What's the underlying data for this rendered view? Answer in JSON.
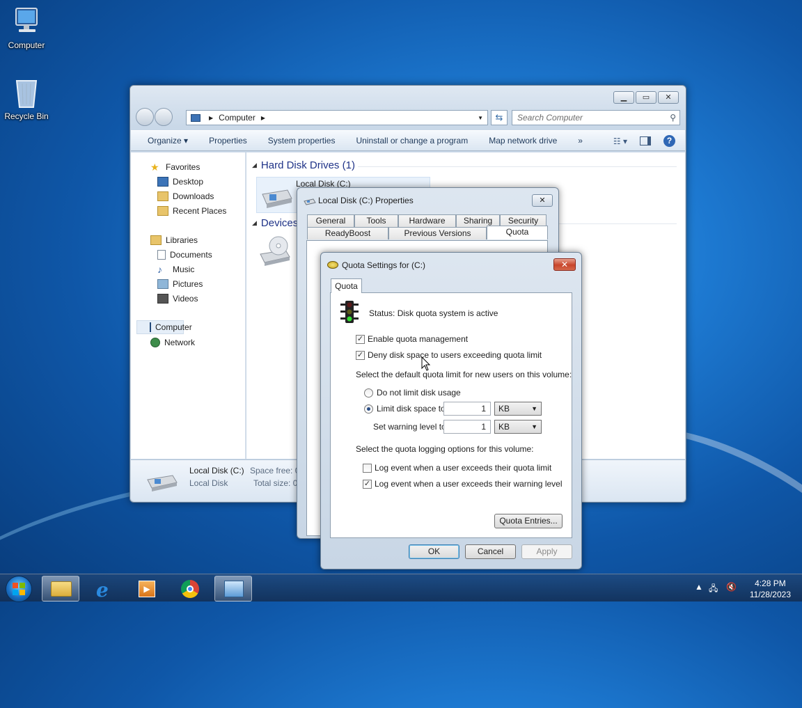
{
  "desktop": {
    "icons": [
      {
        "label": "Computer"
      },
      {
        "label": "Recycle Bin"
      }
    ]
  },
  "explorer": {
    "address": {
      "location": "Computer"
    },
    "search_placeholder": "Search Computer",
    "toolbar": [
      "Organize",
      "Properties",
      "System properties",
      "Uninstall or change a program",
      "Map network drive"
    ],
    "toolbar_more": "»",
    "nav": {
      "favorites": "Favorites",
      "favorites_items": [
        "Desktop",
        "Downloads",
        "Recent Places"
      ],
      "libraries": "Libraries",
      "libraries_items": [
        "Documents",
        "Music",
        "Pictures",
        "Videos"
      ],
      "computer": "Computer",
      "network": "Network"
    },
    "groups": {
      "hard_disks": "Hard Disk Drives (1)",
      "devices": "Devices"
    },
    "drive_label": "Local Disk (C:)",
    "details": {
      "name": "Local Disk (C:)",
      "type": "Local Disk",
      "space_free": "Space free: 0",
      "total_size": "Total size: 0"
    }
  },
  "properties_dialog": {
    "title": "Local Disk (C:) Properties",
    "tabs_row1": [
      "General",
      "Tools",
      "Hardware",
      "Sharing",
      "Security"
    ],
    "tabs_row2": [
      "ReadyBoost",
      "Previous Versions",
      "Quota"
    ],
    "active_tab": "Quota"
  },
  "quota_dialog": {
    "title": "Quota Settings for  (C:)",
    "tab": "Quota",
    "status": "Status:  Disk quota system is active",
    "enable_label": "Enable quota management",
    "enable_checked": true,
    "deny_label": "Deny disk space to users exceeding quota limit",
    "deny_checked": true,
    "default_limit_heading": "Select the default quota limit for new users on this volume:",
    "no_limit_label": "Do not limit disk usage",
    "limit_label": "Limit disk space to",
    "limit_value": "1",
    "limit_unit": "KB",
    "warning_label": "Set warning level to",
    "warning_value": "1",
    "warning_unit": "KB",
    "logging_heading": "Select the quota logging options for this volume:",
    "log_limit_label": "Log event when a user exceeds their quota limit",
    "log_limit_checked": false,
    "log_warning_label": "Log event when a user exceeds their warning level",
    "log_warning_checked": true,
    "entries_button": "Quota Entries...",
    "ok": "OK",
    "cancel": "Cancel",
    "apply": "Apply"
  },
  "taskbar": {
    "time": "4:28 PM",
    "date": "11/28/2023"
  }
}
